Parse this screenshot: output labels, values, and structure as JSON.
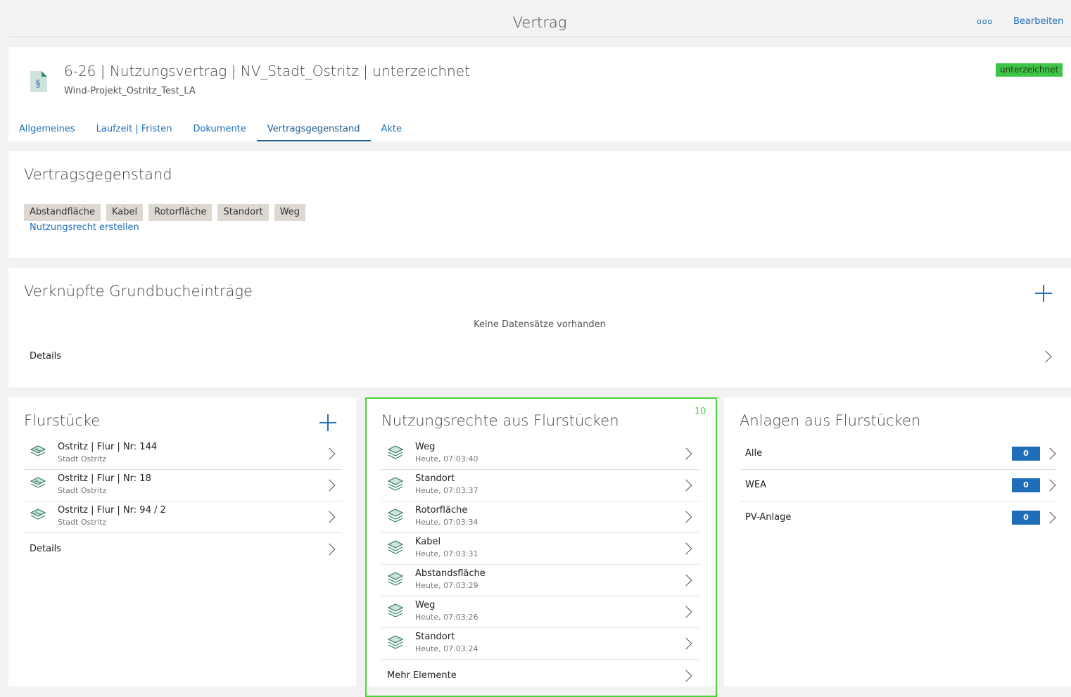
{
  "topbar": {
    "title": "Vertrag",
    "more_label": "ooo",
    "edit_label": "Bearbeiten"
  },
  "record": {
    "title": "6-26 | Nutzungsvertrag | NV_Stadt_Ostritz | unterzeichnet",
    "subtitle": "Wind-Projekt_Ostritz_Test_LA",
    "status": "unterzeichnet",
    "status_color": "#3fc44a",
    "icon": "contract-document-icon"
  },
  "tabs": [
    {
      "label": "Allgemeines"
    },
    {
      "label": "Laufzeit | Fristen"
    },
    {
      "label": "Dokumente"
    },
    {
      "label": "Vertragsgegenstand",
      "active": true
    },
    {
      "label": "Akte"
    }
  ],
  "vertragsgegenstand": {
    "title": "Vertragsgegenstand",
    "chips": [
      "Abstandfläche",
      "Kabel",
      "Rotorfläche",
      "Standort",
      "Weg"
    ],
    "create_link": "Nutzungsrecht erstellen"
  },
  "grundbuch": {
    "title": "Verknüpfte Grundbucheinträge",
    "empty_text": "Keine Datensätze vorhanden",
    "details_label": "Details"
  },
  "flurstuecke": {
    "title": "Flurstücke",
    "items": [
      {
        "title": "Ostritz | Flur | Nr: 144",
        "sub": "Stadt Ostritz"
      },
      {
        "title": "Ostritz | Flur | Nr: 18",
        "sub": "Stadt Ostritz"
      },
      {
        "title": "Ostritz | Flur | Nr: 94 / 2",
        "sub": "Stadt Ostritz"
      }
    ],
    "details_label": "Details"
  },
  "nutzungsrechte": {
    "title": "Nutzungsrechte aus Flurstücken",
    "count": "10",
    "items": [
      {
        "title": "Weg",
        "sub": "Heute, 07:03:40"
      },
      {
        "title": "Standort",
        "sub": "Heute, 07:03:37"
      },
      {
        "title": "Rotorfläche",
        "sub": "Heute, 07:03:34"
      },
      {
        "title": "Kabel",
        "sub": "Heute, 07:03:31"
      },
      {
        "title": "Abstandsfläche",
        "sub": "Heute, 07:03:29"
      },
      {
        "title": "Weg",
        "sub": "Heute, 07:03:26"
      },
      {
        "title": "Standort",
        "sub": "Heute, 07:03:24"
      }
    ],
    "more_label": "Mehr Elemente"
  },
  "anlagen": {
    "title": "Anlagen aus Flurstücken",
    "items": [
      {
        "label": "Alle",
        "count": "0"
      },
      {
        "label": "WEA",
        "count": "0"
      },
      {
        "label": "PV-Anlage",
        "count": "0"
      }
    ]
  },
  "colors": {
    "accent": "#1e6fb8",
    "highlight": "#4bd43a",
    "chip_bg": "#ddd8d1"
  }
}
